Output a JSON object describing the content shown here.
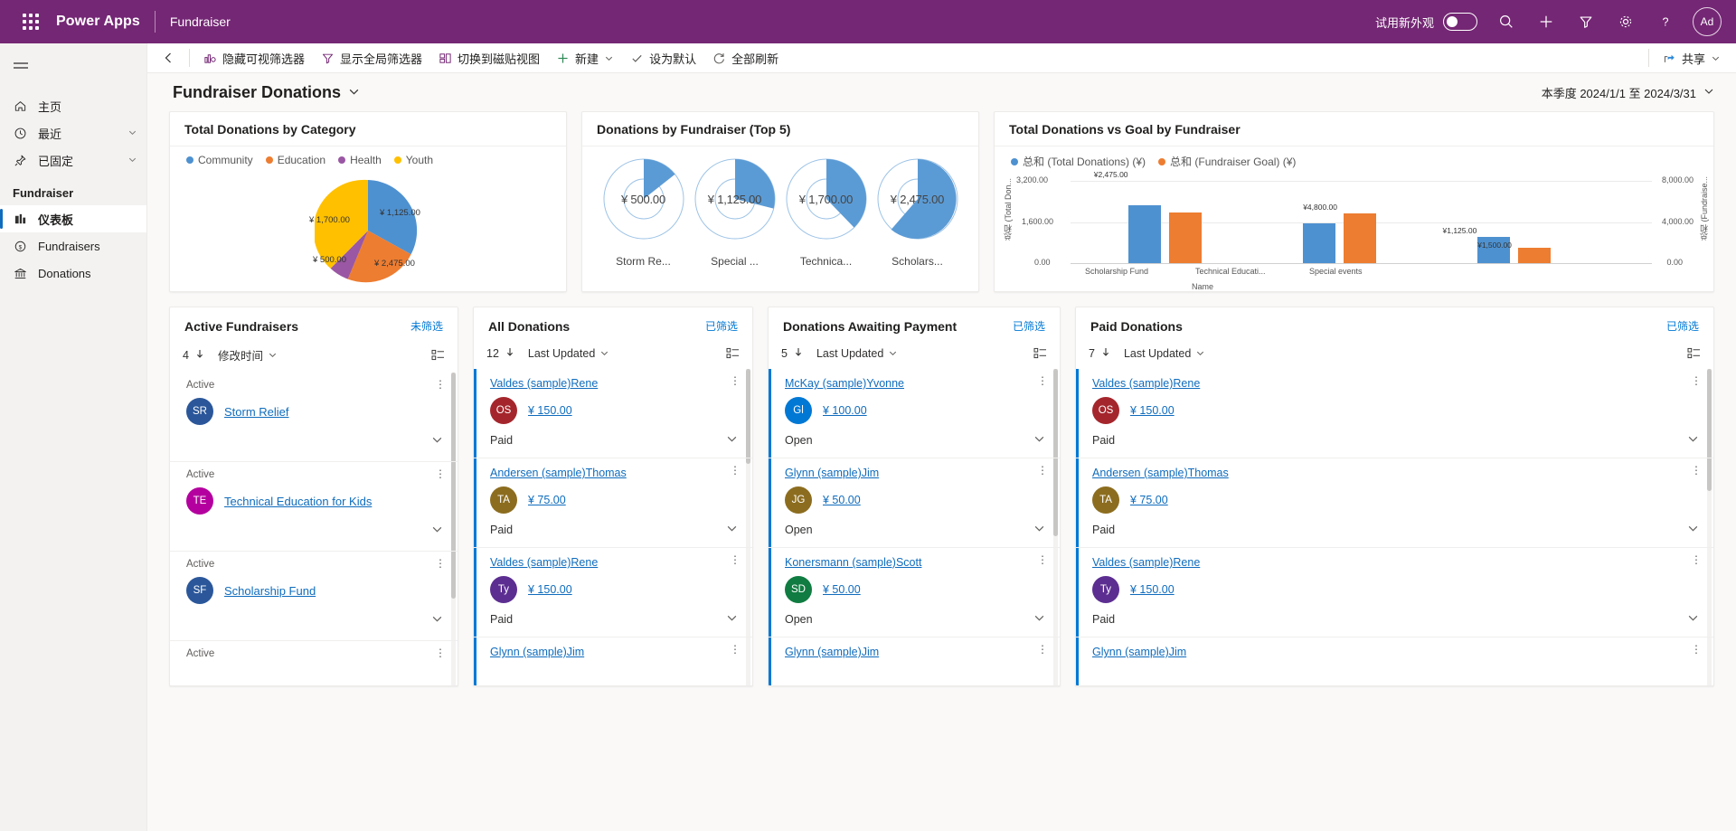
{
  "topbar": {
    "waffle_label": "waffle",
    "brand": "Power Apps",
    "app_name": "Fundraiser",
    "new_look_label": "试用新外观",
    "search_label": "搜索",
    "new_label": "新建",
    "filter_label": "筛选器",
    "settings_label": "设置",
    "help_label": "帮助",
    "avatar_initials": "Ad"
  },
  "sidebar": {
    "items": [
      {
        "label": "主页",
        "icon": "home-icon",
        "chevron": false,
        "selected": false
      },
      {
        "label": "最近",
        "icon": "clock-icon",
        "chevron": true,
        "selected": false
      },
      {
        "label": "已固定",
        "icon": "pin-icon",
        "chevron": true,
        "selected": false
      }
    ],
    "group_title": "Fundraiser",
    "group_items": [
      {
        "label": "仪表板",
        "icon": "dashboard-icon",
        "selected": true
      },
      {
        "label": "Fundraisers",
        "icon": "fundraiser-icon",
        "selected": false
      },
      {
        "label": "Donations",
        "icon": "bank-icon",
        "selected": false
      }
    ]
  },
  "commandbar": {
    "back_label": "后退",
    "items": [
      {
        "label": "隐藏可视筛选器",
        "icon": "visual-filter-icon",
        "chevron": false
      },
      {
        "label": "显示全局筛选器",
        "icon": "funnel-icon",
        "chevron": false
      },
      {
        "label": "切换到磁贴视图",
        "icon": "tile-view-icon",
        "chevron": false
      },
      {
        "label": "新建",
        "icon": "plus-icon",
        "chevron": true
      },
      {
        "label": "设为默认",
        "icon": "check-icon",
        "chevron": false
      },
      {
        "label": "全部刷新",
        "icon": "refresh-icon",
        "chevron": false
      }
    ],
    "share_label": "共享"
  },
  "page": {
    "title": "Fundraiser Donations",
    "date_range": "本季度 2024/1/1 至 2024/3/31"
  },
  "chart_data": [
    {
      "type": "pie",
      "title": "Total Donations by Category",
      "legend_position": "top",
      "legend": [
        "Community",
        "Education",
        "Health",
        "Youth"
      ],
      "categories": [
        "Community",
        "Education",
        "Health",
        "Youth"
      ],
      "values": [
        1125,
        2475,
        500,
        1700
      ],
      "labels": [
        "¥ 1,125.00",
        "¥ 2,475.00",
        "¥ 500.00",
        "¥ 1,700.00"
      ],
      "colors": [
        "#4e91d0",
        "#ed7d31",
        "#9a57a3",
        "#ffc000"
      ]
    },
    {
      "type": "donut",
      "title": "Donations by Fundraiser (Top 5)",
      "items": [
        {
          "name": "Storm Re...",
          "value": 500,
          "label": "¥ 500.00",
          "fraction": 0.14
        },
        {
          "name": "Special ...",
          "value": 1125,
          "label": "¥ 1,125.00",
          "fraction": 0.27
        },
        {
          "name": "Technica...",
          "value": 1700,
          "label": "¥ 1,700.00",
          "fraction": 0.36
        },
        {
          "name": "Scholars...",
          "value": 2475,
          "label": "¥ 2,475.00",
          "fraction": 0.55
        }
      ],
      "color": "#5b9bd5"
    },
    {
      "type": "bar",
      "title": "Total Donations vs Goal by Fundraiser",
      "legend": [
        "总和 (Total Donations) (¥)",
        "总和 (Fundraiser Goal) (¥)"
      ],
      "legend_colors": [
        "#4e91d0",
        "#ed7d31"
      ],
      "categories": [
        "Scholarship Fund",
        "Technical Educati...",
        "Special events"
      ],
      "xlabel": "Name",
      "ylabel_left": "总和 (Total Don...",
      "ylabel_right": "总和 (Fundraise...",
      "yticks_left": [
        "3,200.00",
        "1,600.00",
        "0.00"
      ],
      "yticks_right": [
        "8,000.00",
        "4,000.00",
        "0.00"
      ],
      "ylim_left": [
        0,
        3200
      ],
      "ylim_right": [
        0,
        8000
      ],
      "series": [
        {
          "name": "总和 (Total Donations) (¥)",
          "values": [
            2475,
            1700,
            1125
          ],
          "labels": [
            "¥2,475.00",
            "",
            "¥1,125.00"
          ]
        },
        {
          "name": "总和 (Fundraiser Goal) (¥)",
          "values": [
            5000,
            5000,
            1500
          ],
          "labels": [
            "",
            "¥4,800.00",
            "¥1,500.00"
          ]
        }
      ]
    }
  ],
  "lists": [
    {
      "title": "Active Fundraisers",
      "filter_label": "未筛选",
      "count": "4",
      "sort_label": "修改时间",
      "accent": false,
      "rows": [
        {
          "status": "Active",
          "name": "Storm Relief",
          "pill": "SR",
          "pill_color": "#2b579a",
          "footer": ""
        },
        {
          "status": "Active",
          "name": "Technical Education for Kids",
          "pill": "TE",
          "pill_color": "#b4009e",
          "footer": ""
        },
        {
          "status": "Active",
          "name": "Scholarship Fund",
          "pill": "SF",
          "pill_color": "#2b579a",
          "footer": ""
        },
        {
          "status": "Active",
          "name": "",
          "pill": "",
          "pill_color": "#2b579a",
          "footer": ""
        }
      ]
    },
    {
      "title": "All Donations",
      "filter_label": "已筛选",
      "count": "12",
      "sort_label": "Last Updated",
      "accent": true,
      "rows": [
        {
          "status": "",
          "link": "Valdes (sample)Rene",
          "pill": "OS",
          "pill_color": "#a4262c",
          "amount": "¥ 150.00",
          "footer": "Paid"
        },
        {
          "status": "",
          "link": "Andersen (sample)Thomas",
          "pill": "TA",
          "pill_color": "#8c6d1f",
          "amount": "¥ 75.00",
          "footer": "Paid"
        },
        {
          "status": "",
          "link": "Valdes (sample)Rene",
          "pill": "Ty",
          "pill_color": "#5c2e91",
          "amount": "¥ 150.00",
          "footer": "Paid"
        },
        {
          "status": "",
          "link": "Glynn (sample)Jim",
          "pill": "",
          "pill_color": "#2b579a",
          "amount": "",
          "footer": ""
        }
      ]
    },
    {
      "title": "Donations Awaiting Payment",
      "filter_label": "已筛选",
      "count": "5",
      "sort_label": "Last Updated",
      "accent": true,
      "rows": [
        {
          "status": "",
          "link": "McKay (sample)Yvonne",
          "pill": "Gl",
          "pill_color": "#0078d4",
          "amount": "¥ 100.00",
          "footer": "Open"
        },
        {
          "status": "",
          "link": "Glynn (sample)Jim",
          "pill": "JG",
          "pill_color": "#8c6d1f",
          "amount": "¥ 50.00",
          "footer": "Open"
        },
        {
          "status": "",
          "link": "Konersmann (sample)Scott",
          "pill": "SD",
          "pill_color": "#107c41",
          "amount": "¥ 50.00",
          "footer": "Open"
        },
        {
          "status": "",
          "link": "Glynn (sample)Jim",
          "pill": "",
          "pill_color": "#2b579a",
          "amount": "",
          "footer": ""
        }
      ]
    },
    {
      "title": "Paid Donations",
      "filter_label": "已筛选",
      "count": "7",
      "sort_label": "Last Updated",
      "accent": true,
      "rows": [
        {
          "status": "",
          "link": "Valdes (sample)Rene",
          "pill": "OS",
          "pill_color": "#a4262c",
          "amount": "¥ 150.00",
          "footer": "Paid"
        },
        {
          "status": "",
          "link": "Andersen (sample)Thomas",
          "pill": "TA",
          "pill_color": "#8c6d1f",
          "amount": "¥ 75.00",
          "footer": "Paid"
        },
        {
          "status": "",
          "link": "Valdes (sample)Rene",
          "pill": "Ty",
          "pill_color": "#5c2e91",
          "amount": "¥ 150.00",
          "footer": "Paid"
        },
        {
          "status": "",
          "link": "Glynn (sample)Jim",
          "pill": "",
          "pill_color": "#2b579a",
          "amount": "",
          "footer": ""
        }
      ]
    }
  ]
}
